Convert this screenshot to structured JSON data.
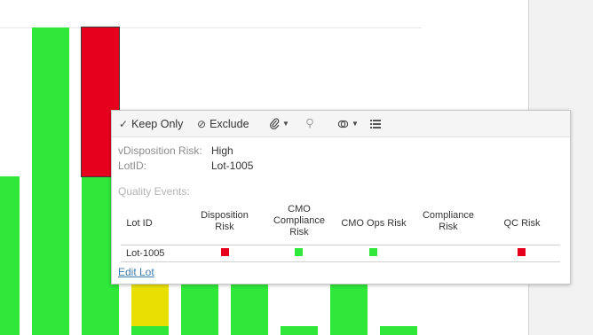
{
  "colors": {
    "green": "#2fe83a",
    "red": "#e6001e",
    "yellow": "#e8e000",
    "link": "#3e7cb0"
  },
  "tooltip": {
    "toolbar": {
      "keep_only": "Keep Only",
      "exclude": "Exclude"
    },
    "fields": [
      {
        "label": "vDisposition Risk:",
        "value": "High"
      },
      {
        "label": "LotID:",
        "value": "Lot-1005"
      }
    ],
    "events_label": "Quality Events:",
    "table": {
      "headers": [
        "Lot ID",
        "Disposition Risk",
        "CMO Compliance Risk",
        "CMO Ops Risk",
        "Compliance Risk",
        "QC Risk"
      ],
      "rows": [
        {
          "lot_id": "Lot-1005",
          "marks": [
            "red",
            "green",
            "green",
            "",
            "red"
          ]
        }
      ]
    },
    "edit_link": "Edit Lot"
  }
}
